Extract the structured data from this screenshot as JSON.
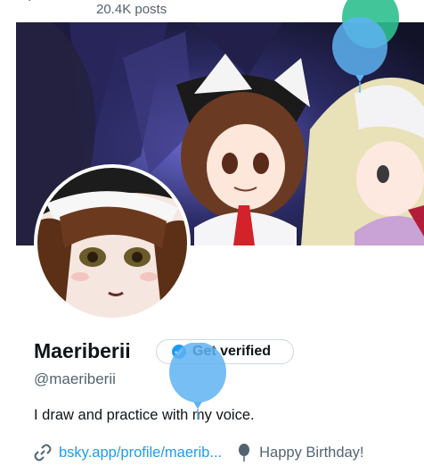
{
  "header": {
    "posts_count": "20.4K posts"
  },
  "profile": {
    "display_name": "Maeriberii",
    "handle": "@maeriberii",
    "bio": "I draw and practice with my voice.",
    "get_verified_label": "Get verified",
    "website": "bsky.app/profile/maerib...",
    "birthday": "Happy Birthday!"
  },
  "icons": {
    "verify": "verified-badge-icon",
    "link": "link-icon",
    "birthday": "balloon-icon"
  },
  "colors": {
    "accent": "#1d9bf0",
    "secondary_text": "#536471",
    "balloon_blue": "#5eb3f2",
    "balloon_green": "#2fbf8f"
  }
}
